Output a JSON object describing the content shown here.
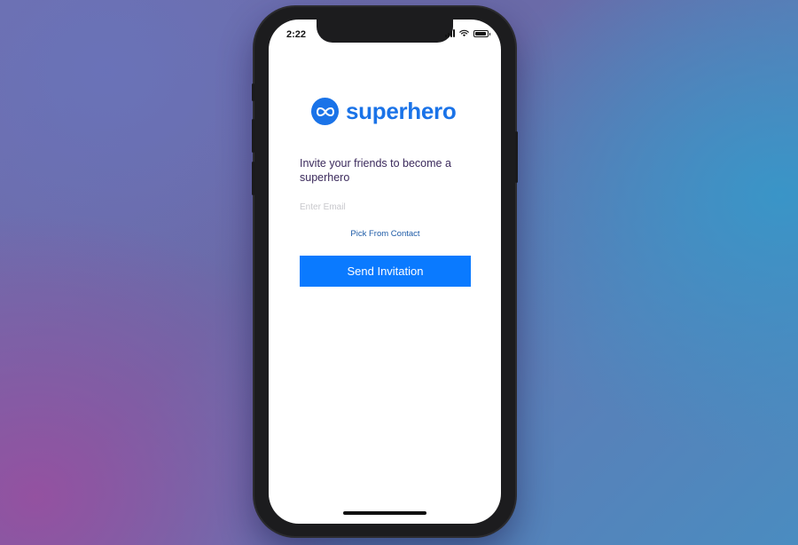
{
  "status_bar": {
    "time": "2:22",
    "icons": [
      "signal-icon",
      "wifi-icon",
      "battery-icon"
    ]
  },
  "brand": {
    "name": "superhero",
    "logo_icon": "infinity-icon",
    "color": "#1a73e8"
  },
  "invite": {
    "text": "Invite your friends to become a superhero"
  },
  "email": {
    "value": "",
    "placeholder": "Enter Email"
  },
  "pick_contact": {
    "label": "Pick From Contact"
  },
  "send_button": {
    "label": "Send Invitation",
    "color": "#0a7aff"
  }
}
